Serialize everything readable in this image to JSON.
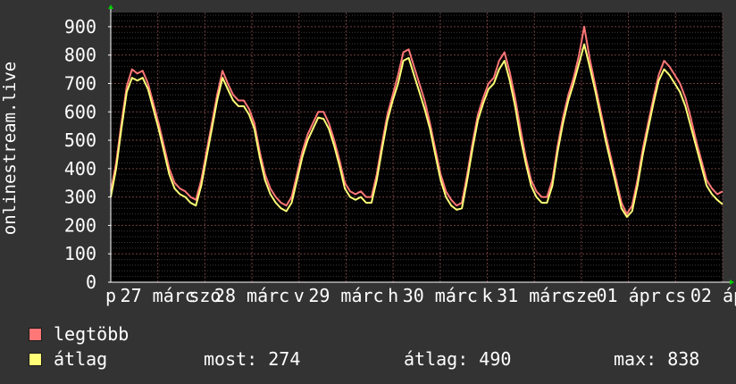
{
  "chart_data": {
    "type": "line",
    "ylabel": "onlinestream.live",
    "ylim": [
      0,
      950
    ],
    "yticks": [
      0,
      100,
      200,
      300,
      400,
      500,
      600,
      700,
      800,
      900
    ],
    "xticks": [
      "p",
      "27 márc",
      "szo",
      "28 márc",
      "v",
      "29 márc",
      "h",
      "30 márc",
      "k",
      "31 márc",
      "sze",
      "01 ápr",
      "cs",
      "02 ápr"
    ],
    "grid": true,
    "series": [
      {
        "name": "legtöbb",
        "color": "#ff7777",
        "values": [
          320,
          420,
          560,
          690,
          750,
          735,
          745,
          700,
          630,
          560,
          480,
          400,
          350,
          330,
          320,
          300,
          290,
          360,
          460,
          560,
          660,
          745,
          700,
          660,
          640,
          640,
          610,
          560,
          460,
          380,
          330,
          300,
          280,
          270,
          300,
          380,
          460,
          520,
          560,
          600,
          600,
          560,
          500,
          430,
          350,
          320,
          310,
          320,
          300,
          300,
          380,
          490,
          590,
          660,
          730,
          810,
          820,
          760,
          700,
          640,
          560,
          470,
          380,
          320,
          290,
          270,
          280,
          380,
          490,
          590,
          650,
          700,
          720,
          780,
          810,
          740,
          650,
          540,
          440,
          360,
          320,
          300,
          300,
          360,
          480,
          580,
          660,
          720,
          800,
          900,
          790,
          700,
          610,
          520,
          440,
          360,
          280,
          240,
          270,
          360,
          470,
          560,
          650,
          730,
          780,
          760,
          730,
          700,
          650,
          580,
          500,
          430,
          360,
          330,
          310,
          320
        ]
      },
      {
        "name": "átlag",
        "color": "#ffff77",
        "values": [
          300,
          400,
          540,
          670,
          720,
          710,
          720,
          680,
          610,
          540,
          460,
          380,
          330,
          310,
          300,
          280,
          270,
          340,
          440,
          540,
          640,
          720,
          680,
          640,
          620,
          620,
          590,
          540,
          440,
          360,
          310,
          280,
          260,
          250,
          280,
          360,
          440,
          500,
          540,
          580,
          575,
          540,
          480,
          410,
          330,
          300,
          290,
          300,
          280,
          280,
          360,
          470,
          570,
          640,
          700,
          780,
          790,
          730,
          670,
          610,
          540,
          450,
          360,
          300,
          270,
          255,
          260,
          360,
          470,
          570,
          630,
          680,
          700,
          750,
          780,
          710,
          620,
          510,
          420,
          340,
          300,
          280,
          280,
          340,
          460,
          560,
          640,
          700,
          770,
          838,
          760,
          680,
          590,
          500,
          420,
          340,
          260,
          230,
          250,
          340,
          450,
          540,
          630,
          710,
          750,
          730,
          700,
          670,
          620,
          550,
          480,
          410,
          340,
          310,
          290,
          274
        ]
      }
    ]
  },
  "legend": {
    "max_label": "legtöbb",
    "avg_label": "átlag",
    "now_text": "most: 274",
    "avg_text": "átlag: 490",
    "max_text": "max: 838"
  }
}
